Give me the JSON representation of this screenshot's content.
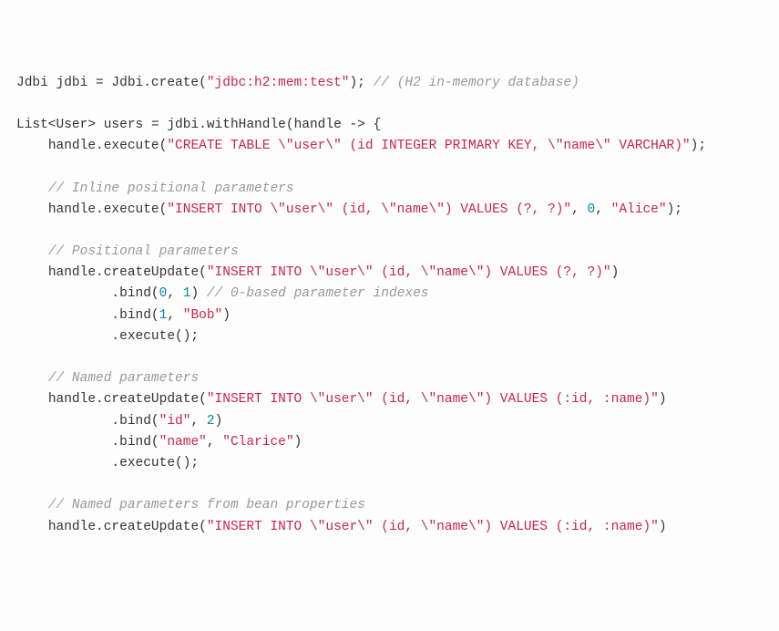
{
  "chart_data": null,
  "code": {
    "lines": [
      {
        "indent": 0,
        "tokens": [
          {
            "t": "Jdbi jdbi ",
            "c": "tok-type"
          },
          {
            "t": "= Jdbi.create(",
            "c": "tok-punc"
          },
          {
            "t": "\"jdbc:h2:mem:test\"",
            "c": "tok-str"
          },
          {
            "t": "); ",
            "c": "tok-punc"
          },
          {
            "t": "// (H2 in-memory database)",
            "c": "tok-comment"
          }
        ]
      },
      {
        "indent": 0,
        "tokens": [
          {
            "t": "",
            "c": ""
          }
        ]
      },
      {
        "indent": 0,
        "tokens": [
          {
            "t": "List<User> users ",
            "c": "tok-type"
          },
          {
            "t": "= jdbi.withHandle(handle -> {",
            "c": "tok-punc"
          }
        ]
      },
      {
        "indent": 1,
        "tokens": [
          {
            "t": "handle.execute(",
            "c": "tok-punc"
          },
          {
            "t": "\"CREATE TABLE \\\"user\\\" (id INTEGER PRIMARY KEY, \\\"name\\\" VARCHAR)\"",
            "c": "tok-str"
          },
          {
            "t": ");",
            "c": "tok-punc"
          }
        ]
      },
      {
        "indent": 0,
        "tokens": [
          {
            "t": "",
            "c": ""
          }
        ]
      },
      {
        "indent": 1,
        "tokens": [
          {
            "t": "// Inline positional parameters",
            "c": "tok-comment"
          }
        ]
      },
      {
        "indent": 1,
        "tokens": [
          {
            "t": "handle.execute(",
            "c": "tok-punc"
          },
          {
            "t": "\"INSERT INTO \\\"user\\\" (id, \\\"name\\\") VALUES (?, ?)\"",
            "c": "tok-str"
          },
          {
            "t": ", ",
            "c": "tok-punc"
          },
          {
            "t": "0",
            "c": "tok-num"
          },
          {
            "t": ", ",
            "c": "tok-punc"
          },
          {
            "t": "\"Alice\"",
            "c": "tok-str"
          },
          {
            "t": ");",
            "c": "tok-punc"
          }
        ]
      },
      {
        "indent": 0,
        "tokens": [
          {
            "t": "",
            "c": ""
          }
        ]
      },
      {
        "indent": 1,
        "tokens": [
          {
            "t": "// Positional parameters",
            "c": "tok-comment"
          }
        ]
      },
      {
        "indent": 1,
        "tokens": [
          {
            "t": "handle.createUpdate(",
            "c": "tok-punc"
          },
          {
            "t": "\"INSERT INTO \\\"user\\\" (id, \\\"name\\\") VALUES (?, ?)\"",
            "c": "tok-str"
          },
          {
            "t": ")",
            "c": "tok-punc"
          }
        ]
      },
      {
        "indent": 3,
        "tokens": [
          {
            "t": ".bind(",
            "c": "tok-punc"
          },
          {
            "t": "0",
            "c": "tok-num"
          },
          {
            "t": ", ",
            "c": "tok-punc"
          },
          {
            "t": "1",
            "c": "tok-num"
          },
          {
            "t": ") ",
            "c": "tok-punc"
          },
          {
            "t": "// 0-based parameter indexes",
            "c": "tok-comment"
          }
        ]
      },
      {
        "indent": 3,
        "tokens": [
          {
            "t": ".bind(",
            "c": "tok-punc"
          },
          {
            "t": "1",
            "c": "tok-num"
          },
          {
            "t": ", ",
            "c": "tok-punc"
          },
          {
            "t": "\"Bob\"",
            "c": "tok-str"
          },
          {
            "t": ")",
            "c": "tok-punc"
          }
        ]
      },
      {
        "indent": 3,
        "tokens": [
          {
            "t": ".execute();",
            "c": "tok-punc"
          }
        ]
      },
      {
        "indent": 0,
        "tokens": [
          {
            "t": "",
            "c": ""
          }
        ]
      },
      {
        "indent": 1,
        "tokens": [
          {
            "t": "// Named parameters",
            "c": "tok-comment"
          }
        ]
      },
      {
        "indent": 1,
        "tokens": [
          {
            "t": "handle.createUpdate(",
            "c": "tok-punc"
          },
          {
            "t": "\"INSERT INTO \\\"user\\\" (id, \\\"name\\\") VALUES (:id, :name)\"",
            "c": "tok-str"
          },
          {
            "t": ")",
            "c": "tok-punc"
          }
        ]
      },
      {
        "indent": 3,
        "tokens": [
          {
            "t": ".bind(",
            "c": "tok-punc"
          },
          {
            "t": "\"id\"",
            "c": "tok-str"
          },
          {
            "t": ", ",
            "c": "tok-punc"
          },
          {
            "t": "2",
            "c": "tok-num"
          },
          {
            "t": ")",
            "c": "tok-punc"
          }
        ]
      },
      {
        "indent": 3,
        "tokens": [
          {
            "t": ".bind(",
            "c": "tok-punc"
          },
          {
            "t": "\"name\"",
            "c": "tok-str"
          },
          {
            "t": ", ",
            "c": "tok-punc"
          },
          {
            "t": "\"Clarice\"",
            "c": "tok-str"
          },
          {
            "t": ")",
            "c": "tok-punc"
          }
        ]
      },
      {
        "indent": 3,
        "tokens": [
          {
            "t": ".execute();",
            "c": "tok-punc"
          }
        ]
      },
      {
        "indent": 0,
        "tokens": [
          {
            "t": "",
            "c": ""
          }
        ]
      },
      {
        "indent": 1,
        "tokens": [
          {
            "t": "// Named parameters from bean properties",
            "c": "tok-comment"
          }
        ]
      },
      {
        "indent": 1,
        "tokens": [
          {
            "t": "handle.createUpdate(",
            "c": "tok-punc"
          },
          {
            "t": "\"INSERT INTO \\\"user\\\" (id, \\\"name\\\") VALUES (:id, :name)\"",
            "c": "tok-str"
          },
          {
            "t": ")",
            "c": "tok-punc"
          }
        ]
      }
    ]
  }
}
